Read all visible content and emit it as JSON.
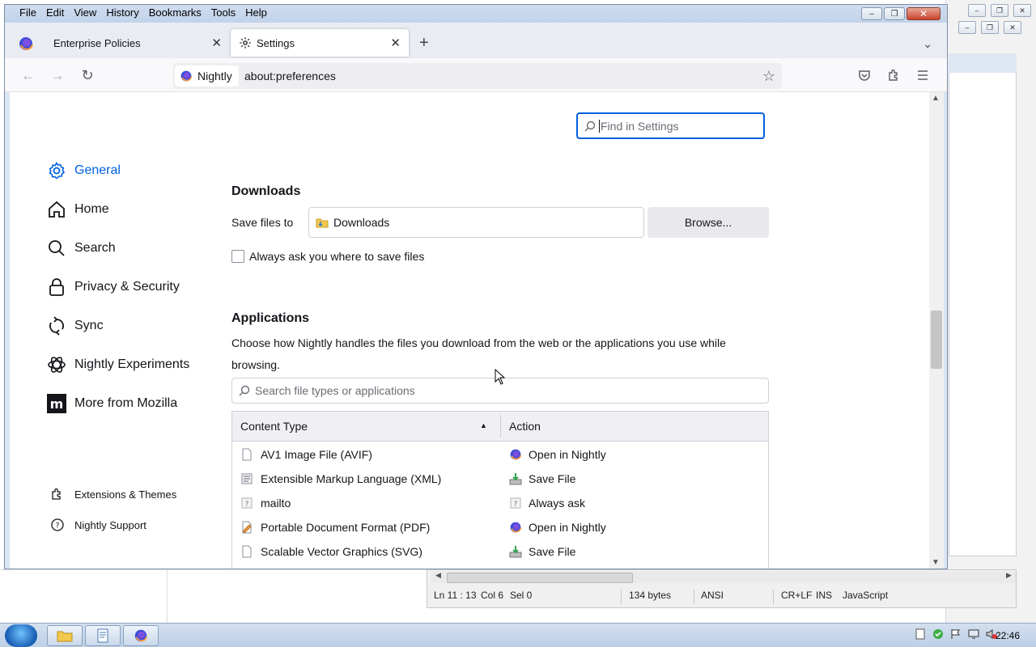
{
  "menubar": [
    "File",
    "Edit",
    "View",
    "History",
    "Bookmarks",
    "Tools",
    "Help"
  ],
  "tabs": {
    "inactive": {
      "label": "Enterprise Policies"
    },
    "active": {
      "label": "Settings"
    }
  },
  "urlbar": {
    "identity": "Nightly",
    "url": "about:preferences"
  },
  "settings": {
    "find_placeholder": "Find in Settings",
    "sidebar": [
      {
        "label": "General",
        "icon": "gear-icon",
        "selected": true
      },
      {
        "label": "Home",
        "icon": "home-icon"
      },
      {
        "label": "Search",
        "icon": "search-icon"
      },
      {
        "label": "Privacy & Security",
        "icon": "lock-icon"
      },
      {
        "label": "Sync",
        "icon": "sync-icon"
      },
      {
        "label": "Nightly Experiments",
        "icon": "experiments-icon"
      },
      {
        "label": "More from Mozilla",
        "icon": "mozilla-icon"
      }
    ],
    "sidebar_footer": [
      {
        "label": "Extensions & Themes",
        "icon": "puzzle-icon"
      },
      {
        "label": "Nightly Support",
        "icon": "help-icon"
      }
    ],
    "downloads": {
      "heading": "Downloads",
      "save_label": "Save files to",
      "folder": "Downloads",
      "browse": "Browse...",
      "always_ask": "Always ask you where to save files",
      "always_ask_checked": false
    },
    "applications": {
      "heading": "Applications",
      "description": "Choose how Nightly handles the files you download from the web or the applications you use while browsing.",
      "search_placeholder": "Search file types or applications",
      "columns": [
        "Content Type",
        "Action"
      ],
      "rows": [
        {
          "type": "AV1 Image File (AVIF)",
          "action": "Open in Nightly",
          "type_icon": "file-icon",
          "action_icon": "nightly-icon"
        },
        {
          "type": "Extensible Markup Language (XML)",
          "action": "Save File",
          "type_icon": "xml-file-icon",
          "action_icon": "save-icon"
        },
        {
          "type": "mailto",
          "action": "Always ask",
          "type_icon": "mailto-icon",
          "action_icon": "ask-icon"
        },
        {
          "type": "Portable Document Format (PDF)",
          "action": "Open in Nightly",
          "type_icon": "pdf-icon",
          "action_icon": "nightly-icon"
        },
        {
          "type": "Scalable Vector Graphics (SVG)",
          "action": "Save File",
          "type_icon": "file-icon",
          "action_icon": "save-icon"
        }
      ]
    }
  },
  "editor_status": {
    "position": "Ln 11 : 13",
    "col": "Col 6",
    "sel": "Sel 0",
    "size": "134 bytes",
    "encoding": "ANSI",
    "eol": "CR+LF",
    "mode": "INS",
    "language": "JavaScript"
  },
  "taskbar": {
    "clock": "22:46"
  },
  "colors": {
    "accent": "#0061e0",
    "text": "#15141a"
  }
}
